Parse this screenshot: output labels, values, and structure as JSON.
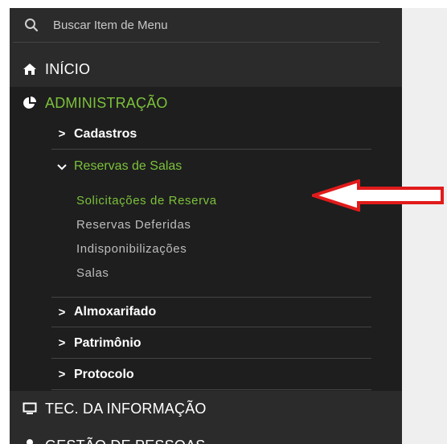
{
  "search": {
    "placeholder": "Buscar Item de Menu",
    "icon": "search-icon"
  },
  "menu": {
    "inicio": {
      "label": "INÍCIO",
      "icon": "home-icon"
    },
    "administracao": {
      "label": "ADMINISTRAÇÃO",
      "icon": "pie-chart-icon",
      "color": "#7cc13b",
      "submenu": {
        "cadastros": "Cadastros",
        "reservas_de_salas": {
          "label": "Reservas de Salas",
          "items": {
            "solicitacoes": "Solicitações de Reserva",
            "deferidas": "Reservas Deferidas",
            "indisponibilizacoes": "Indisponibilizações",
            "salas": "Salas"
          }
        },
        "almoxarifado": "Almoxarifado",
        "patrimonio": "Patrimônio",
        "protocolo": "Protocolo"
      }
    },
    "tec_informacao": {
      "label": "TEC. DA INFORMAÇÃO",
      "icon": "monitor-icon"
    },
    "gestao_pessoas": {
      "label": "GESTÃO DE PESSOAS",
      "icon": "user-icon"
    }
  },
  "annotation": {
    "icon": "red-arrow-icon",
    "color": "#e11b1b"
  }
}
